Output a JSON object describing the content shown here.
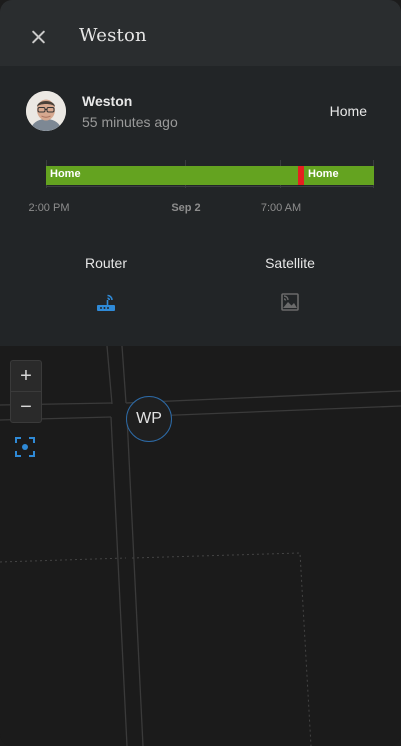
{
  "header": {
    "title": "Weston",
    "close_icon": "close-icon"
  },
  "person": {
    "name": "Weston",
    "last_changed": "55 minutes ago",
    "state": "Home",
    "avatar_icon": "person-avatar"
  },
  "timeline": {
    "segments": [
      {
        "label": "Home",
        "state": "home",
        "color": "#64a320"
      },
      {
        "label": "",
        "state": "away",
        "color": "#e52020"
      },
      {
        "label": "Home",
        "state": "home",
        "color": "#64a320"
      }
    ],
    "ticks": [
      "2:00 PM",
      "Sep 2",
      "7:00 AM"
    ]
  },
  "tabs": [
    {
      "label": "Router",
      "icon": "router-icon",
      "color": "#2f8ad7"
    },
    {
      "label": "Satellite",
      "icon": "satellite-image-icon",
      "color": "#6a6a6a"
    }
  ],
  "map": {
    "zoom_in_label": "+",
    "zoom_out_label": "−",
    "locate_icon": "locate-icon",
    "marker_label": "WP"
  }
}
